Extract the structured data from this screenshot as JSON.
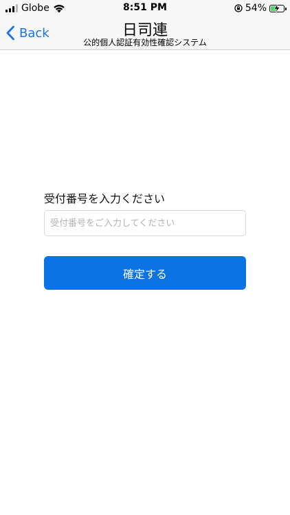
{
  "status_bar": {
    "carrier": "Globe",
    "time": "8:51 PM",
    "battery_percent": "54%",
    "battery_level": 0.54,
    "battery_color": "#4cd964"
  },
  "nav": {
    "back_label": "Back",
    "title": "日司連",
    "subtitle": "公的個人認証有効性確認システム",
    "accent_color": "#1a73e8"
  },
  "form": {
    "label": "受付番号を入力ください",
    "input_placeholder": "受付番号をご入力してください",
    "input_value": "",
    "submit_label": "確定する",
    "submit_color": "#0b73e3"
  },
  "icons": {
    "signal": "signal-bars-icon",
    "wifi": "wifi-icon",
    "rotation_lock": "rotation-lock-icon",
    "battery": "battery-charging-icon",
    "back": "chevron-left-icon"
  }
}
